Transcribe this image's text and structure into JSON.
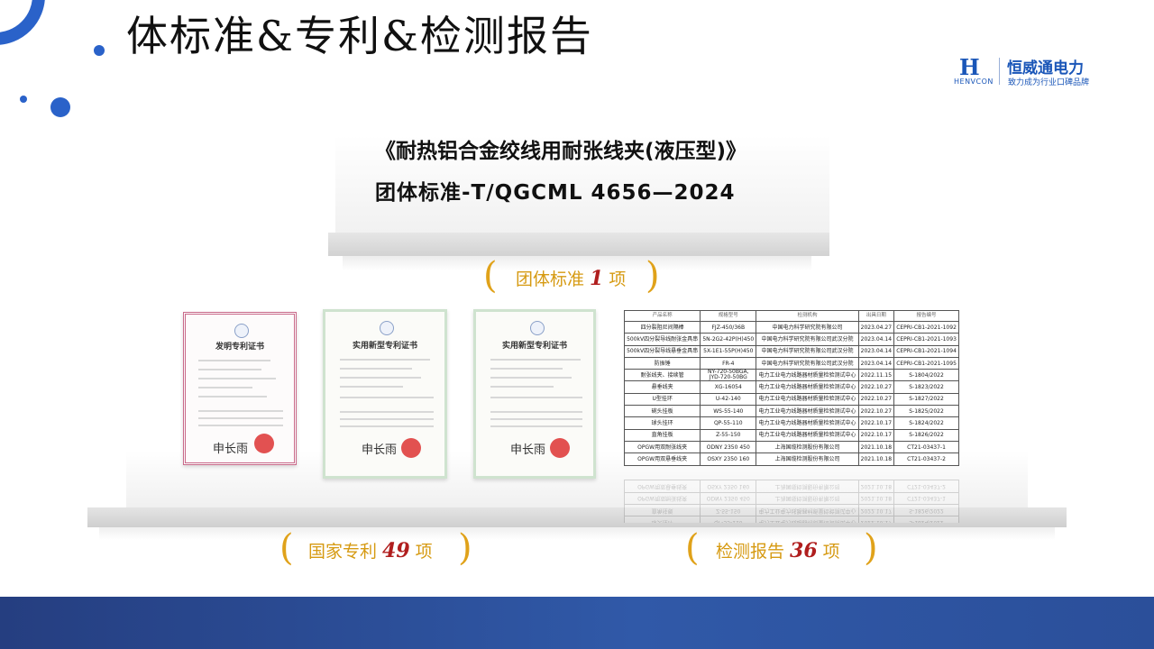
{
  "title": "体标准&专利&检测报告",
  "logo": {
    "mark": "H",
    "english": "HENVCON",
    "company": "恒威通电力",
    "slogan": "致力成为行业口碑品牌"
  },
  "standard": {
    "name": "《耐热铝合金绞线用耐张线夹(液压型)》",
    "code": "团体标准-T/QGCML 4656—2024"
  },
  "counts": {
    "group_standard": {
      "label": "团体标准",
      "value": "1",
      "unit": "项"
    },
    "patents": {
      "label": "国家专利",
      "value": "49",
      "unit": "项"
    },
    "reports": {
      "label": "检测报告",
      "value": "36",
      "unit": "项"
    }
  },
  "certificates": {
    "invention": {
      "title": "发明专利证书",
      "sign": "申长雨"
    },
    "utility_1": {
      "title": "实用新型专利证书",
      "sign": "申长雨"
    },
    "utility_2": {
      "title": "实用新型专利证书",
      "sign": "申长雨"
    }
  },
  "report_table": {
    "headers": [
      "产品名称",
      "规格型号",
      "检测机构",
      "出具日期",
      "报告编号"
    ],
    "rows": [
      [
        "四分裂阻尼间隔棒",
        "FJZ-450/36B",
        "中国电力科学研究院有限公司",
        "2023.04.27",
        "CEPRI-CB1-2021-1092"
      ],
      [
        "500kV四分裂导线耐张金具串",
        "5N-2G2-42P(H)450",
        "中国电力科学研究院有限公司武汉分院",
        "2023.04.14",
        "CEPRI-CB1-2021-1093"
      ],
      [
        "500kV四分裂导线悬垂金具串",
        "5X-1E1-55P(H)450",
        "中国电力科学研究院有限公司武汉分院",
        "2023.04.14",
        "CEPRI-CB1-2021-1094"
      ],
      [
        "防振锤",
        "FR-4",
        "中国电力科学研究院有限公司武汉分院",
        "2023.04.14",
        "CEPRI-CB1-2021-1095"
      ],
      [
        "耐张线夹、接续管",
        "NY-720-50BGA,\nJYD-720-50BG",
        "电力工业电力线路器材质量检验测试中心",
        "2022.11.15",
        "S-1804/2022"
      ],
      [
        "悬垂线夹",
        "XG-16054",
        "电力工业电力线路器材质量检验测试中心",
        "2022.10.27",
        "S-1823/2022"
      ],
      [
        "U型挂环",
        "U-42-140",
        "电力工业电力线路器材质量检验测试中心",
        "2022.10.27",
        "S-1827/2022"
      ],
      [
        "碗头挂板",
        "WS-55-140",
        "电力工业电力线路器材质量检验测试中心",
        "2022.10.27",
        "S-1825/2022"
      ],
      [
        "球头挂环",
        "QP-55-110",
        "电力工业电力线路器材质量检验测试中心",
        "2022.10.17",
        "S-1824/2022"
      ],
      [
        "直角挂板",
        "Z-55-150",
        "电力工业电力线路器材质量检验测试中心",
        "2022.10.17",
        "S-1826/2022"
      ],
      [
        "OPGW用双耐张线夹",
        "ODNY 2350 450",
        "上海国缆检测股份有限公司",
        "2021.10.18",
        "CT21-03437-1"
      ],
      [
        "OPGW用双悬垂线夹",
        "OSXY 2350 160",
        "上海国缆检测股份有限公司",
        "2021.10.18",
        "CT21-03437-2"
      ]
    ]
  }
}
